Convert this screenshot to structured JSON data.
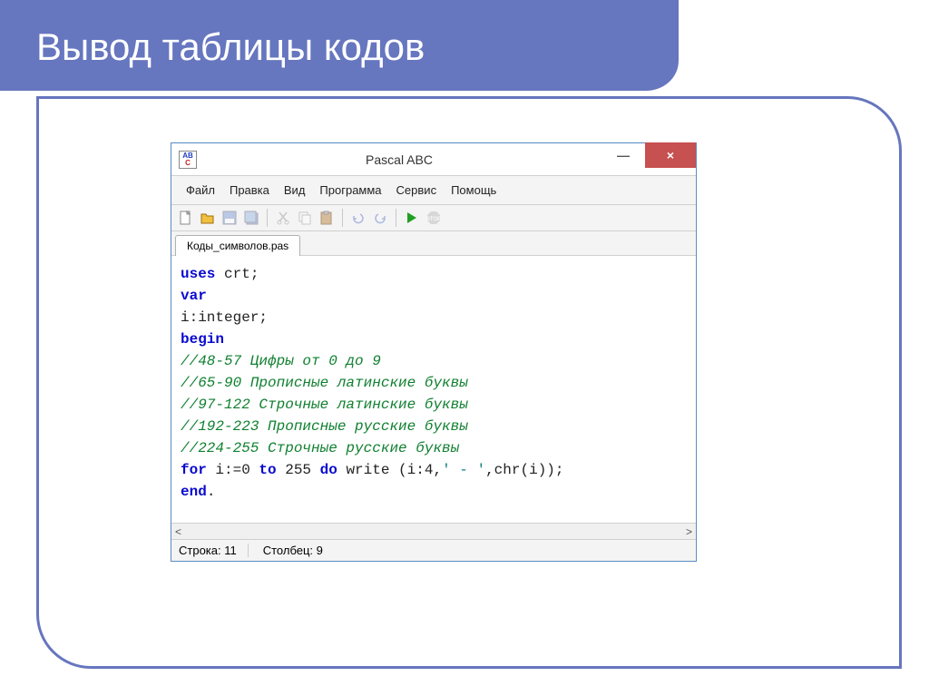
{
  "slide": {
    "title": "Вывод таблицы кодов"
  },
  "window": {
    "title": "Pascal ABC",
    "icon": {
      "top": "AB",
      "bottom": "C"
    },
    "buttons": {
      "min": "—",
      "close": "×"
    }
  },
  "menu": {
    "file": "Файл",
    "edit": "Правка",
    "view": "Вид",
    "program": "Программа",
    "service": "Сервис",
    "help": "Помощь"
  },
  "tab": {
    "label": "Коды_символов.pas"
  },
  "code": {
    "l1a": "uses",
    "l1b": " crt;",
    "l2": "var",
    "l3": "i:integer;",
    "l4": "begin",
    "l5": "//48-57 Цифры от 0 до 9",
    "l6": "//65-90 Прописные латинские буквы",
    "l7": "//97-122 Строчные латинские буквы",
    "l8": "//192-223 Прописные русские буквы",
    "l9": "//224-255 Строчные русские буквы",
    "l10a": "for",
    "l10b": " i:=0 ",
    "l10c": "to",
    "l10d": " 255 ",
    "l10e": "do",
    "l10f": " write (i:4,",
    "l10g": "' - '",
    "l10h": ",chr(i));",
    "l11a": "end",
    "l11b": "."
  },
  "status": {
    "row": "Строка: 11",
    "col": "Столбец: 9"
  }
}
